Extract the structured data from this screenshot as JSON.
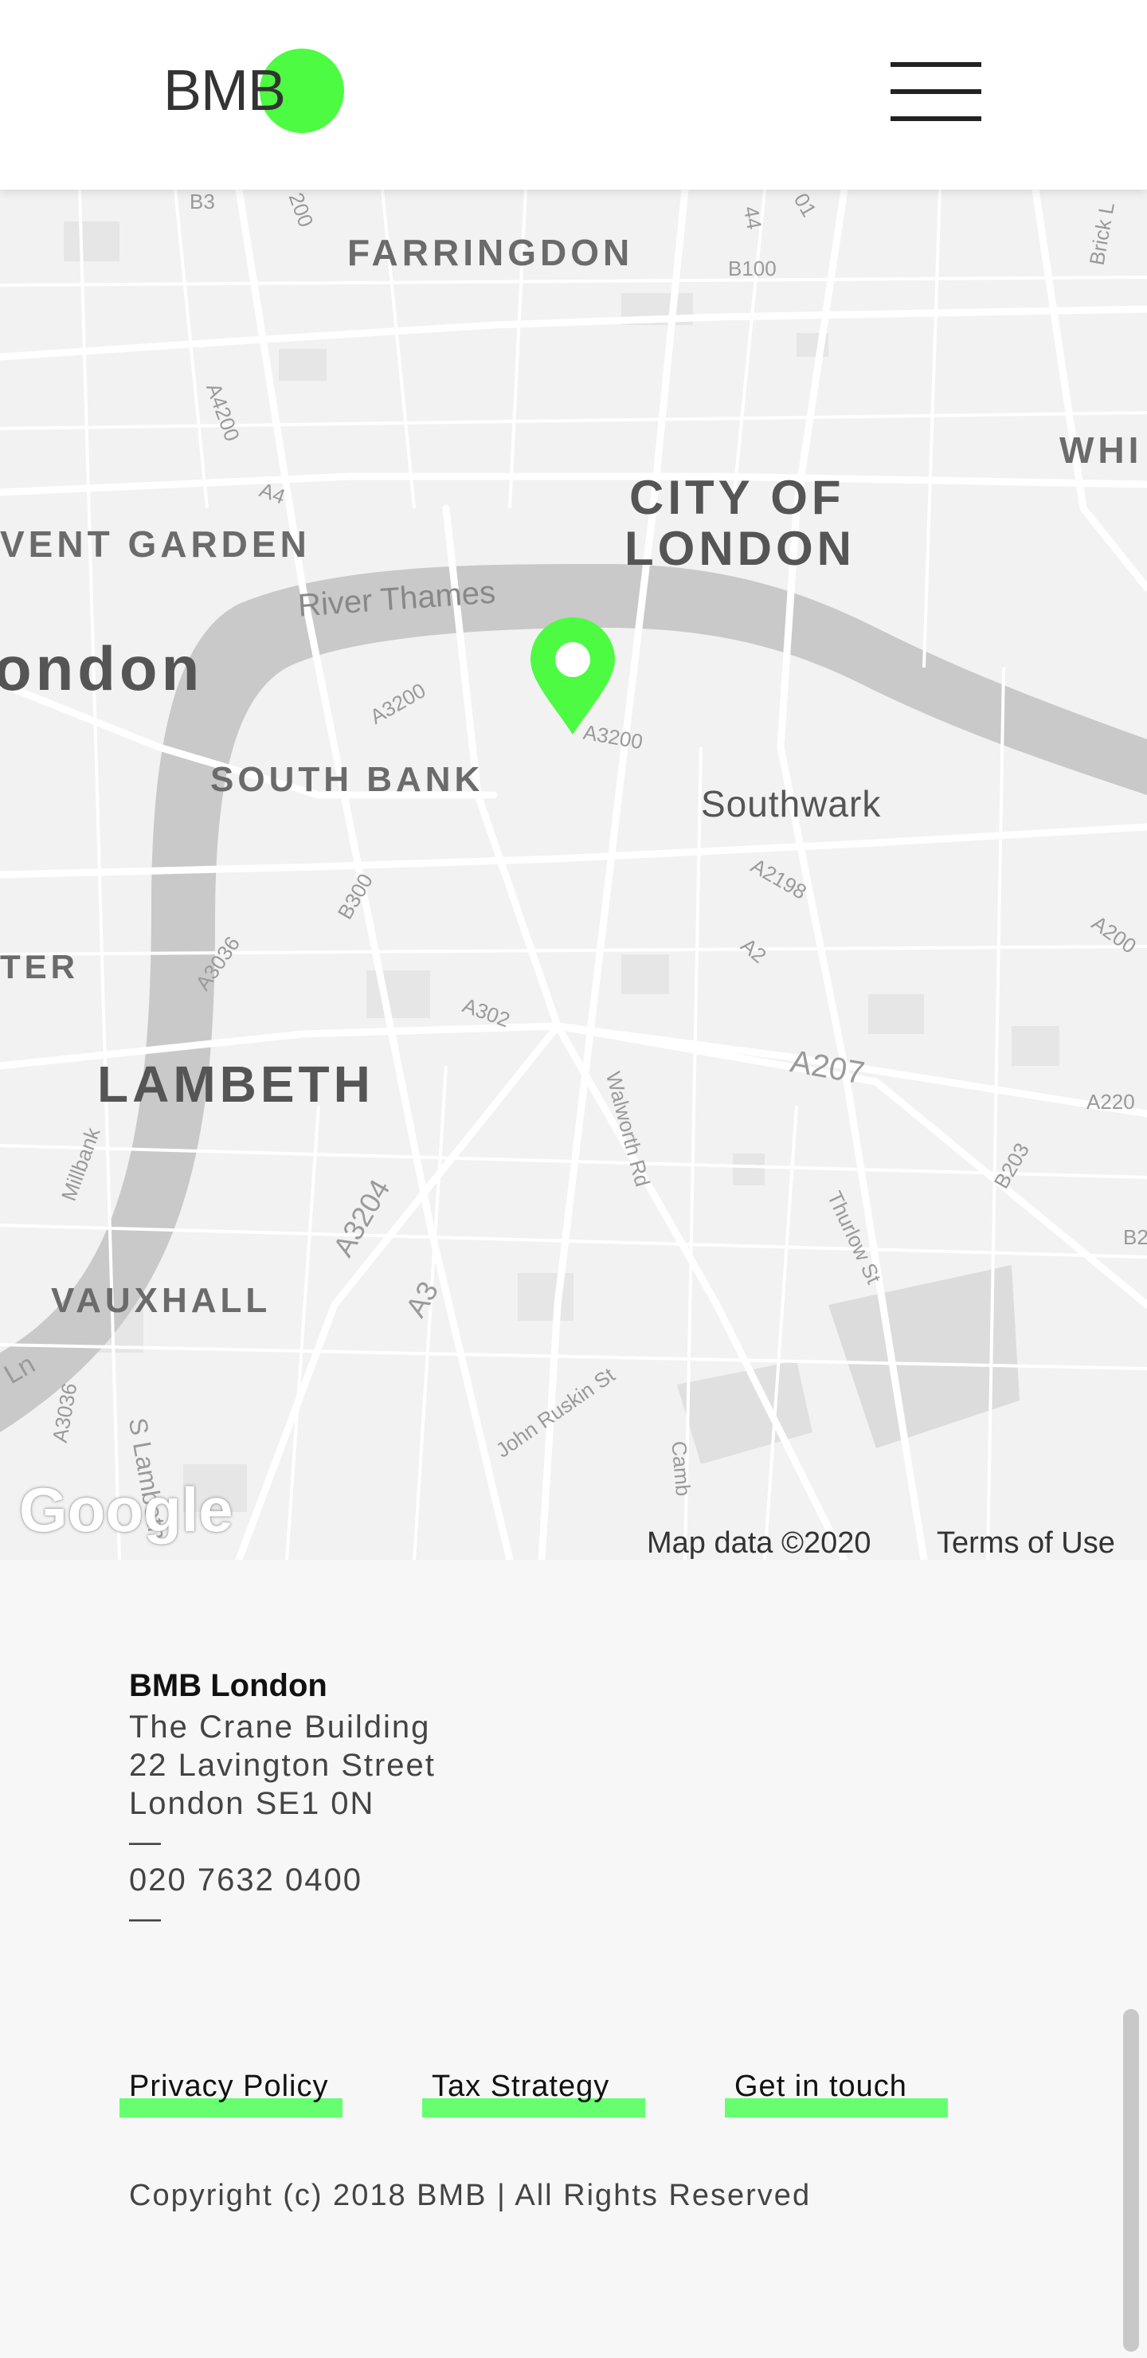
{
  "header": {
    "logo_text": "BMB",
    "menu_icon": "hamburger-menu-icon"
  },
  "map": {
    "places": {
      "farringdon": "FARRINGDON",
      "city_of_london_1": "CITY OF",
      "city_of_london_2": "LONDON",
      "covent_garden": "VENT GARDEN",
      "london": "ondon",
      "south_bank": "SOUTH BANK",
      "southwark": "Southwark",
      "lambeth": "LAMBETH",
      "vauxhall": "VAUXHALL",
      "whi": "WHI",
      "ter": "TER"
    },
    "roads": {
      "river": "River Thames",
      "b100": "B100",
      "a4200": "A4200",
      "a4": "A4",
      "a3200_1": "A3200",
      "a3200_2": "A3200",
      "b300": "B300",
      "a3036": "A3036",
      "a302": "A302",
      "a2198": "A2198",
      "a2": "A2",
      "a207": "A207",
      "a3204": "A3204",
      "a3": "A3",
      "walworth": "Walworth Rd",
      "thurlow": "Thurlow St",
      "b203": "B203",
      "millbank": "Millbank",
      "john_ruskin": "John Ruskin St",
      "a3036_2": "A3036",
      "s_lambeth": "S Lambeth",
      "a200": "A200",
      "a220": "A220",
      "b2": "B2",
      "brick_lane": "Brick L",
      "camb": "Camb",
      "ln": "Ln",
      "a200b": "200",
      "a44": "44",
      "a01": "01",
      "b3": "B3"
    },
    "pin_icon": "map-pin-icon",
    "google_logo": "Google",
    "map_data": "Map data ©2020",
    "terms": "Terms of Use",
    "colors": {
      "pin": "#4dfb43",
      "river": "#c9c9c9"
    }
  },
  "footer": {
    "office_name": "BMB London",
    "address_lines": [
      "The Crane Building",
      "22 Lavington Street",
      "London SE1 0N",
      "—",
      "020 7632 0400",
      "—"
    ],
    "links": [
      "Privacy Policy",
      "Tax Strategy",
      "Get in touch"
    ],
    "copyright": "Copyright (c) 2018 BMB | All Rights Reserved",
    "accent": "#66ff70"
  }
}
